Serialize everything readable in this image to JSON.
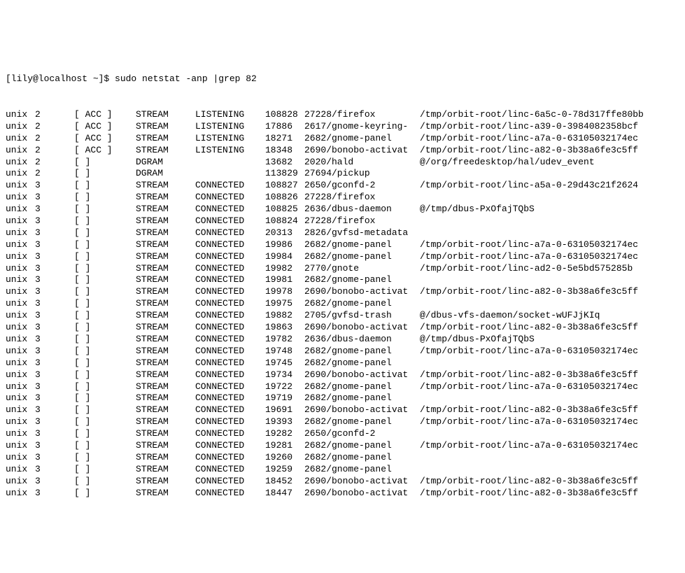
{
  "prompt": "[lily@localhost ~]$ sudo netstat -anp |grep 82",
  "rows": [
    {
      "proto": "unix",
      "refcnt": "2",
      "flags": "[ ACC ]",
      "type": "STREAM",
      "state": "LISTENING",
      "inode": "108828",
      "pid": "27228/firefox",
      "path": "/tmp/orbit-root/linc-6a5c-0-78d317ffe80bb"
    },
    {
      "proto": "unix",
      "refcnt": "2",
      "flags": "[ ACC ]",
      "type": "STREAM",
      "state": "LISTENING",
      "inode": "17886",
      "pid": "2617/gnome-keyring-",
      "path": "/tmp/orbit-root/linc-a39-0-3984082358bcf"
    },
    {
      "proto": "unix",
      "refcnt": "2",
      "flags": "[ ACC ]",
      "type": "STREAM",
      "state": "LISTENING",
      "inode": "18271",
      "pid": "2682/gnome-panel",
      "path": "/tmp/orbit-root/linc-a7a-0-63105032174ec"
    },
    {
      "proto": "unix",
      "refcnt": "2",
      "flags": "[ ACC ]",
      "type": "STREAM",
      "state": "LISTENING",
      "inode": "18348",
      "pid": "2690/bonobo-activat",
      "path": "/tmp/orbit-root/linc-a82-0-3b38a6fe3c5ff"
    },
    {
      "proto": "unix",
      "refcnt": "2",
      "flags": "[ ]",
      "type": "DGRAM",
      "state": "",
      "inode": "13682",
      "pid": "2020/hald",
      "path": "@/org/freedesktop/hal/udev_event"
    },
    {
      "proto": "unix",
      "refcnt": "2",
      "flags": "[ ]",
      "type": "DGRAM",
      "state": "",
      "inode": "113829",
      "pid": "27694/pickup",
      "path": ""
    },
    {
      "proto": "unix",
      "refcnt": "3",
      "flags": "[ ]",
      "type": "STREAM",
      "state": "CONNECTED",
      "inode": "108827",
      "pid": "2650/gconfd-2",
      "path": "/tmp/orbit-root/linc-a5a-0-29d43c21f2624"
    },
    {
      "proto": "unix",
      "refcnt": "3",
      "flags": "[ ]",
      "type": "STREAM",
      "state": "CONNECTED",
      "inode": "108826",
      "pid": "27228/firefox",
      "path": ""
    },
    {
      "proto": "unix",
      "refcnt": "3",
      "flags": "[ ]",
      "type": "STREAM",
      "state": "CONNECTED",
      "inode": "108825",
      "pid": "2636/dbus-daemon",
      "path": "@/tmp/dbus-PxOfajTQbS"
    },
    {
      "proto": "unix",
      "refcnt": "3",
      "flags": "[ ]",
      "type": "STREAM",
      "state": "CONNECTED",
      "inode": "108824",
      "pid": "27228/firefox",
      "path": ""
    },
    {
      "proto": "unix",
      "refcnt": "3",
      "flags": "[ ]",
      "type": "STREAM",
      "state": "CONNECTED",
      "inode": "20313",
      "pid": "2826/gvfsd-metadata",
      "path": ""
    },
    {
      "proto": "unix",
      "refcnt": "3",
      "flags": "[ ]",
      "type": "STREAM",
      "state": "CONNECTED",
      "inode": "19986",
      "pid": "2682/gnome-panel",
      "path": "/tmp/orbit-root/linc-a7a-0-63105032174ec"
    },
    {
      "proto": "unix",
      "refcnt": "3",
      "flags": "[ ]",
      "type": "STREAM",
      "state": "CONNECTED",
      "inode": "19984",
      "pid": "2682/gnome-panel",
      "path": "/tmp/orbit-root/linc-a7a-0-63105032174ec"
    },
    {
      "proto": "unix",
      "refcnt": "3",
      "flags": "[ ]",
      "type": "STREAM",
      "state": "CONNECTED",
      "inode": "19982",
      "pid": "2770/gnote",
      "path": "/tmp/orbit-root/linc-ad2-0-5e5bd575285b"
    },
    {
      "proto": "unix",
      "refcnt": "3",
      "flags": "[ ]",
      "type": "STREAM",
      "state": "CONNECTED",
      "inode": "19981",
      "pid": "2682/gnome-panel",
      "path": ""
    },
    {
      "proto": "unix",
      "refcnt": "3",
      "flags": "[ ]",
      "type": "STREAM",
      "state": "CONNECTED",
      "inode": "19978",
      "pid": "2690/bonobo-activat",
      "path": "/tmp/orbit-root/linc-a82-0-3b38a6fe3c5ff"
    },
    {
      "proto": "unix",
      "refcnt": "3",
      "flags": "[ ]",
      "type": "STREAM",
      "state": "CONNECTED",
      "inode": "19975",
      "pid": "2682/gnome-panel",
      "path": ""
    },
    {
      "proto": "unix",
      "refcnt": "3",
      "flags": "[ ]",
      "type": "STREAM",
      "state": "CONNECTED",
      "inode": "19882",
      "pid": "2705/gvfsd-trash",
      "path": "@/dbus-vfs-daemon/socket-wUFJjKIq"
    },
    {
      "proto": "unix",
      "refcnt": "3",
      "flags": "[ ]",
      "type": "STREAM",
      "state": "CONNECTED",
      "inode": "19863",
      "pid": "2690/bonobo-activat",
      "path": "/tmp/orbit-root/linc-a82-0-3b38a6fe3c5ff"
    },
    {
      "proto": "unix",
      "refcnt": "3",
      "flags": "[ ]",
      "type": "STREAM",
      "state": "CONNECTED",
      "inode": "19782",
      "pid": "2636/dbus-daemon",
      "path": "@/tmp/dbus-PxOfajTQbS"
    },
    {
      "proto": "unix",
      "refcnt": "3",
      "flags": "[ ]",
      "type": "STREAM",
      "state": "CONNECTED",
      "inode": "19748",
      "pid": "2682/gnome-panel",
      "path": "/tmp/orbit-root/linc-a7a-0-63105032174ec"
    },
    {
      "proto": "unix",
      "refcnt": "3",
      "flags": "[ ]",
      "type": "STREAM",
      "state": "CONNECTED",
      "inode": "19745",
      "pid": "2682/gnome-panel",
      "path": ""
    },
    {
      "proto": "unix",
      "refcnt": "3",
      "flags": "[ ]",
      "type": "STREAM",
      "state": "CONNECTED",
      "inode": "19734",
      "pid": "2690/bonobo-activat",
      "path": "/tmp/orbit-root/linc-a82-0-3b38a6fe3c5ff"
    },
    {
      "proto": "unix",
      "refcnt": "3",
      "flags": "[ ]",
      "type": "STREAM",
      "state": "CONNECTED",
      "inode": "19722",
      "pid": "2682/gnome-panel",
      "path": "/tmp/orbit-root/linc-a7a-0-63105032174ec"
    },
    {
      "proto": "unix",
      "refcnt": "3",
      "flags": "[ ]",
      "type": "STREAM",
      "state": "CONNECTED",
      "inode": "19719",
      "pid": "2682/gnome-panel",
      "path": ""
    },
    {
      "proto": "unix",
      "refcnt": "3",
      "flags": "[ ]",
      "type": "STREAM",
      "state": "CONNECTED",
      "inode": "19691",
      "pid": "2690/bonobo-activat",
      "path": "/tmp/orbit-root/linc-a82-0-3b38a6fe3c5ff"
    },
    {
      "proto": "unix",
      "refcnt": "3",
      "flags": "[ ]",
      "type": "STREAM",
      "state": "CONNECTED",
      "inode": "19393",
      "pid": "2682/gnome-panel",
      "path": "/tmp/orbit-root/linc-a7a-0-63105032174ec"
    },
    {
      "proto": "unix",
      "refcnt": "3",
      "flags": "[ ]",
      "type": "STREAM",
      "state": "CONNECTED",
      "inode": "19282",
      "pid": "2650/gconfd-2",
      "path": ""
    },
    {
      "proto": "unix",
      "refcnt": "3",
      "flags": "[ ]",
      "type": "STREAM",
      "state": "CONNECTED",
      "inode": "19281",
      "pid": "2682/gnome-panel",
      "path": "/tmp/orbit-root/linc-a7a-0-63105032174ec"
    },
    {
      "proto": "unix",
      "refcnt": "3",
      "flags": "[ ]",
      "type": "STREAM",
      "state": "CONNECTED",
      "inode": "19260",
      "pid": "2682/gnome-panel",
      "path": ""
    },
    {
      "proto": "unix",
      "refcnt": "3",
      "flags": "[ ]",
      "type": "STREAM",
      "state": "CONNECTED",
      "inode": "19259",
      "pid": "2682/gnome-panel",
      "path": ""
    },
    {
      "proto": "unix",
      "refcnt": "3",
      "flags": "[ ]",
      "type": "STREAM",
      "state": "CONNECTED",
      "inode": "18452",
      "pid": "2690/bonobo-activat",
      "path": "/tmp/orbit-root/linc-a82-0-3b38a6fe3c5ff"
    },
    {
      "proto": "unix",
      "refcnt": "3",
      "flags": "[ ]",
      "type": "STREAM",
      "state": "CONNECTED",
      "inode": "18447",
      "pid": "2690/bonobo-activat",
      "path": "/tmp/orbit-root/linc-a82-0-3b38a6fe3c5ff"
    }
  ]
}
